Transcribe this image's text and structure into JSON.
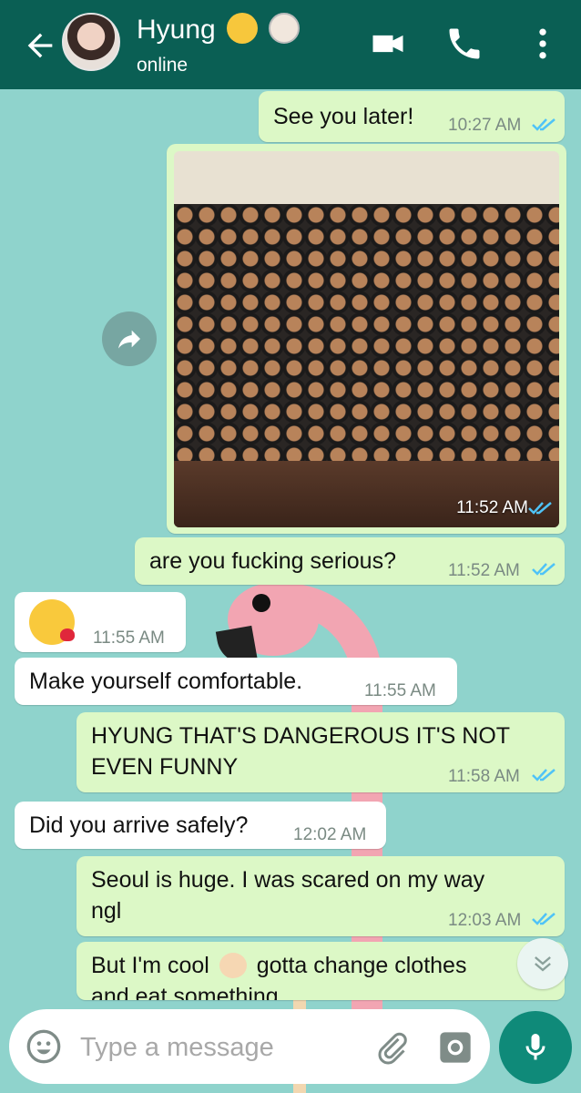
{
  "header": {
    "contact_name": "Hyung",
    "status": "online",
    "name_emojis": [
      "kissing-face-emoji",
      "cook-emoji"
    ],
    "icons": [
      "back-arrow-icon",
      "video-call-icon",
      "phone-icon",
      "more-vert-icon"
    ]
  },
  "messages": [
    {
      "dir": "out",
      "text": "See you later!",
      "time": "10:27 AM",
      "read": true
    },
    {
      "dir": "out",
      "type": "image",
      "time": "11:52 AM",
      "read": true
    },
    {
      "dir": "out",
      "text": "are you fucking serious?",
      "time": "11:52 AM",
      "read": true
    },
    {
      "dir": "in",
      "emoji": "face-blowing-kiss-emoji",
      "time": "11:55 AM"
    },
    {
      "dir": "in",
      "text": "Make yourself comfortable.",
      "time": "11:55 AM"
    },
    {
      "dir": "out",
      "text_line1": "HYUNG THAT'S DANGEROUS IT'S NOT",
      "text_line2": "EVEN FUNNY",
      "time": "11:58 AM",
      "read": true
    },
    {
      "dir": "in",
      "text": "Did you arrive safely?",
      "time": "12:02 AM"
    },
    {
      "dir": "out",
      "text_line1": "Seoul is huge. I was scared on my way",
      "text_line2": "ngl",
      "time": "12:03 AM",
      "read": true
    },
    {
      "dir": "out",
      "text_line1a": "But I'm cool",
      "text_line1b": "gotta change clothes",
      "text_line2": "and eat something",
      "emoji": "ok-hand-emoji"
    }
  ],
  "composer": {
    "placeholder": "Type a message",
    "icons": [
      "emoji-icon",
      "attach-icon",
      "camera-icon",
      "mic-icon"
    ]
  },
  "colors": {
    "header": "#0a5f54",
    "outgoing_bubble": "#dcf8c6",
    "incoming_bubble": "#ffffff",
    "read_ticks": "#4fc3f7",
    "mic_button": "#0f8a79"
  }
}
